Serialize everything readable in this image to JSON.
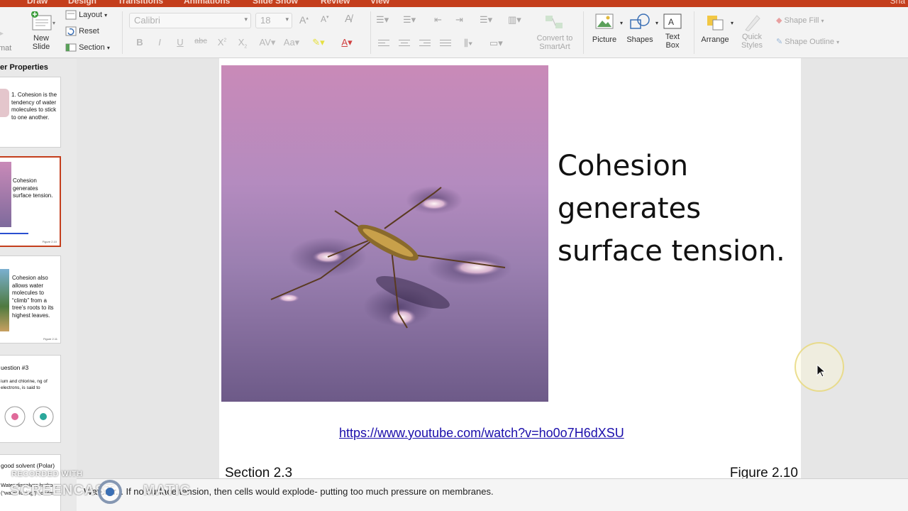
{
  "ribbon_tabs": [
    "Draw",
    "Design",
    "Transitions",
    "Animations",
    "Slide Show",
    "Review",
    "View"
  ],
  "share_label": "Sha",
  "ribbon": {
    "format_partial": "mat",
    "new_slide": "New\nSlide",
    "layout": "Layout",
    "reset": "Reset",
    "section": "Section",
    "font_name": "Calibri",
    "font_size": "18",
    "convert_smartart": "Convert to\nSmartArt",
    "picture": "Picture",
    "shapes": "Shapes",
    "text_box": "Text\nBox",
    "arrange": "Arrange",
    "quick_styles": "Quick\nStyles",
    "shape_fill": "Shape Fill",
    "shape_outline": "Shape Outline"
  },
  "thumbnails": [
    {
      "title": "er Properties",
      "text": "1. Cohesion is the tendency of water molecules to stick to one another."
    },
    {
      "text": "Cohesion generates surface tension.",
      "caption": "Figure 2.10",
      "active": true
    },
    {
      "text": "Cohesion also allows water molecules to “climb” from a tree’s roots to its highest leaves.",
      "caption": "Figure 2.11"
    },
    {
      "title": "uestion #3",
      "text": "ium and chlorine, ng of electrons, is said to"
    },
    {
      "title": "good solvent (Polar)",
      "text": "Water dissolves hydro... (“water-loving”) solutes."
    }
  ],
  "slide": {
    "title": "Cohesion generates surface tension.",
    "link": "https://www.youtube.com/watch?v=ho0o7H6dXSU",
    "section": "Section 2.3",
    "figure": "Figure 2.10"
  },
  "notes": "Water tr...  If no surface tension, then cells would explode- putting too much pressure on membranes.",
  "watermark": {
    "line1": "RECORDED WITH",
    "line2": "SCREENCAST",
    "line3": "MATIC"
  },
  "colors": {
    "accent": "#c43e1c",
    "link": "#1a0dab"
  }
}
